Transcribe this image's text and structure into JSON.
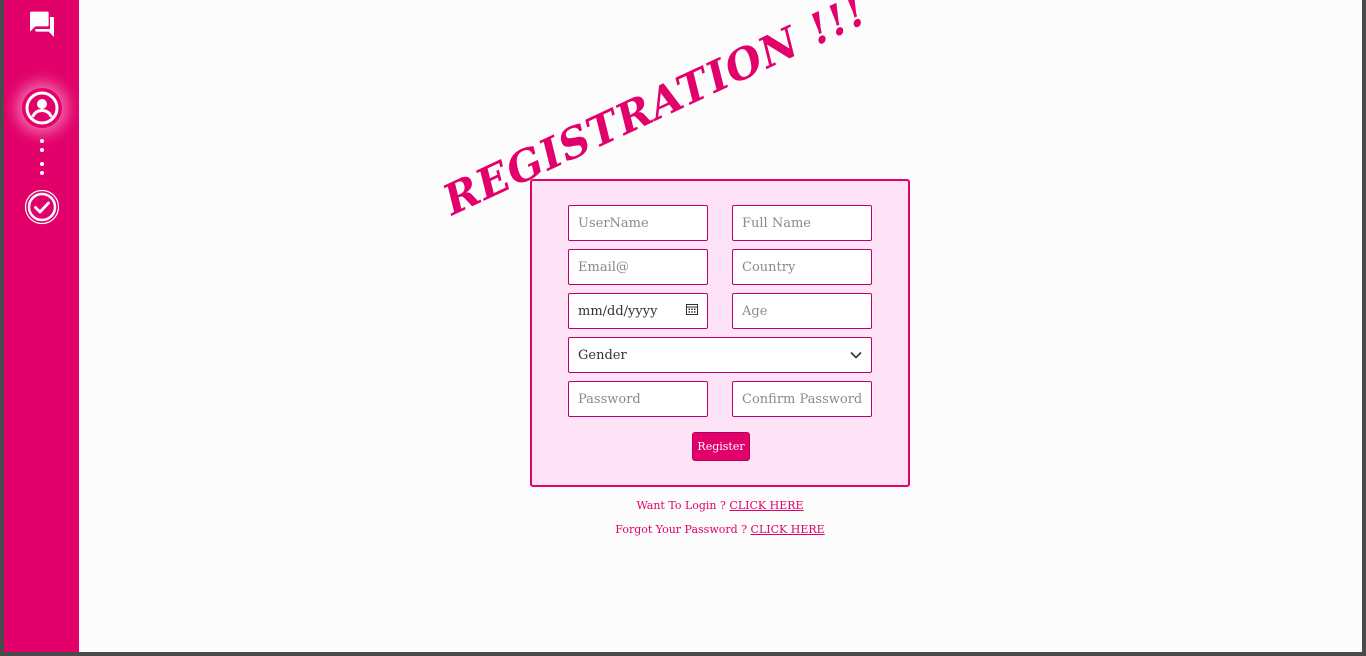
{
  "sidebar": {
    "icons": [
      "chat-icon",
      "user-circle-icon",
      "check-circle-icon"
    ]
  },
  "title": "REGISTRATION !!!",
  "form": {
    "username_placeholder": "UserName",
    "fullname_placeholder": "Full Name",
    "email_placeholder": "Email@",
    "country_placeholder": "Country",
    "dob_placeholder": "mm/dd/yyyy",
    "age_placeholder": "Age",
    "gender_selected": "Gender",
    "password_placeholder": "Password",
    "confirm_password_placeholder": "Confirm Password",
    "register_label": "Register"
  },
  "links": {
    "login_text": "Want To Login ?",
    "login_link": "CLICK HERE",
    "forgot_text": "Forgot Your Password ?",
    "forgot_link": "CLICK HERE"
  },
  "colors": {
    "accent": "#e2006b",
    "card_bg": "#fde3f5",
    "page_bg": "#fcfcfc"
  }
}
